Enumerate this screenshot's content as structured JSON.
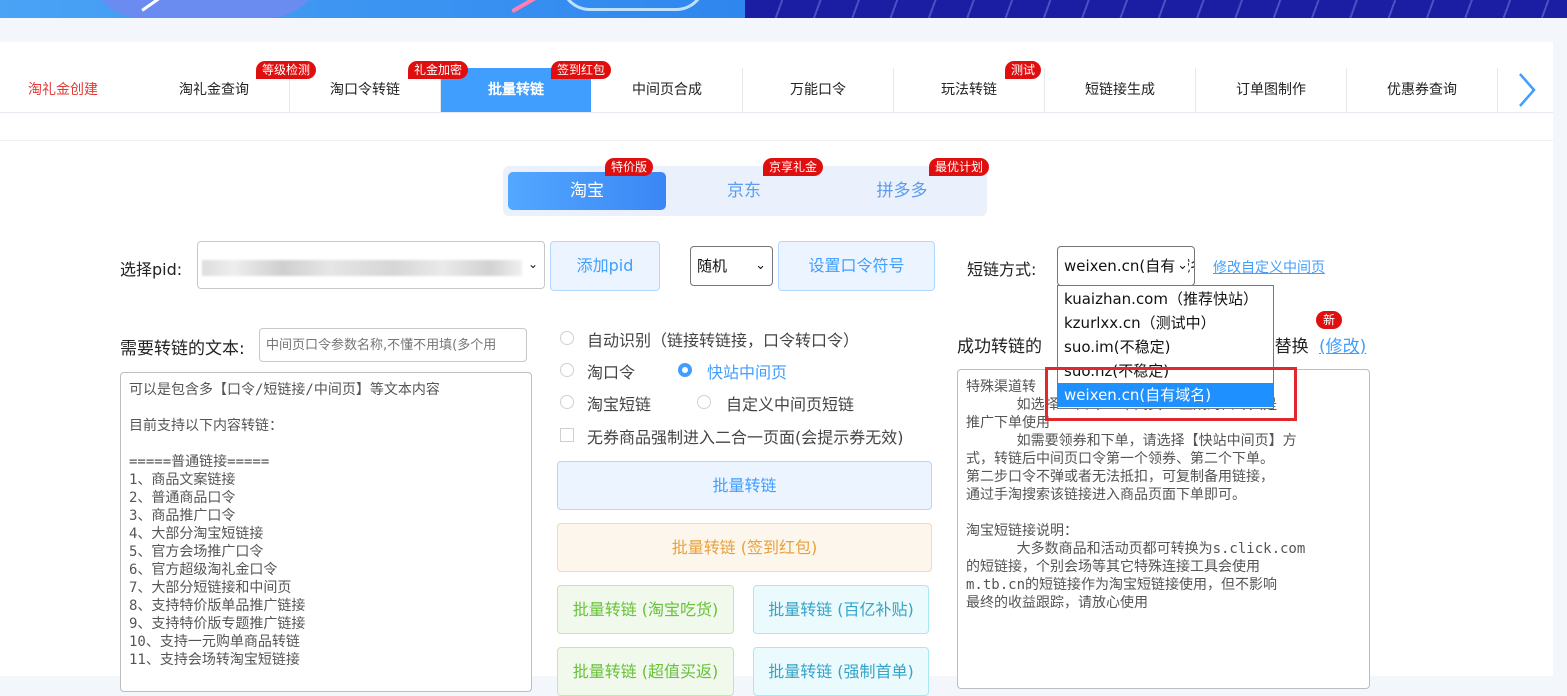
{
  "nav": {
    "tabs": [
      {
        "label": "淘礼金创建"
      },
      {
        "label": "淘礼金查询"
      },
      {
        "label": "淘口令转链"
      },
      {
        "label": "批量转链"
      },
      {
        "label": "中间页合成"
      },
      {
        "label": "万能口令"
      },
      {
        "label": "玩法转链"
      },
      {
        "label": "短链接生成"
      },
      {
        "label": "订单图制作"
      },
      {
        "label": "优惠券查询"
      }
    ],
    "badges": {
      "grade": "等级检测",
      "encrypt": "礼金加密",
      "redpack": "签到红包",
      "test": "测试"
    },
    "next_icon": "chevron-right-icon"
  },
  "platforms": {
    "items": [
      {
        "label": "淘宝",
        "badge": "特价版"
      },
      {
        "label": "京东",
        "badge": "京享礼金"
      },
      {
        "label": "拼多多",
        "badge": "最优计划"
      }
    ]
  },
  "pid": {
    "label": "选择pid:",
    "add_button": "添加pid",
    "random_value": "随机",
    "set_symbol_button": "设置口令符号"
  },
  "shortlink": {
    "label": "短链方式:",
    "selected": "weixen.cn(自有域名)",
    "edit_link": "修改自定义中间页",
    "options": [
      "kuaizhan.com（推荐快站）",
      "kzurlxx.cn（测试中）",
      "suo.im(不稳定)",
      "suo.nz(不稳定)",
      "weixen.cn(自有域名)"
    ]
  },
  "input": {
    "label": "需要转链的文本:",
    "param_placeholder": "中间页口令参数名称,不懂不用填(多个用",
    "text": "可以是包含多【口令/短链接/中间页】等文本内容\n\n目前支持以下内容转链：\n\n=====普通链接=====\n1、商品文案链接\n2、普通商品口令\n3、商品推广口令\n4、大部分淘宝短链接\n5、官方会场推广口令\n6、官方超级淘礼金口令\n7、大部分短链接和中间页\n8、支持特价版单品推广链接\n9、支持特价版专题推广链接\n10、支持一元购单商品转链\n11、支持会场转淘宝短链接"
  },
  "options": {
    "auto": "自动识别（链接转链接，口令转口令）",
    "tkl": "淘口令",
    "kuaizhan": "快站中间页",
    "taobao_short": "淘宝短链",
    "custom_mid": "自定义中间页短链",
    "force_checkbox": "无券商品强制进入二合一页面(会提示券无效)"
  },
  "buttons": {
    "batch": "批量转链",
    "batch_redpack": "批量转链 (签到红包)",
    "batch_food": "批量转链 (淘宝吃货)",
    "batch_subsidy": "批量转链 (百亿补贴)",
    "batch_cashback": "批量转链 (超值买返)",
    "batch_first": "批量转链 (强制首单)"
  },
  "output": {
    "label_left": "成功转链的",
    "label_right": "]替换",
    "edit_link": "(修改)",
    "new_badge": "新",
    "text": "特殊渠道转\n      如选择  口令  中间页  生成的口令只是\n推广下单使用\n      如需要领券和下单，请选择【快站中间页】方\n式，转链后中间页口令第一个领券、第二个下单。\n第二步口令不弹或者无法抵扣，可复制备用链接，\n通过手淘搜索该链接进入商品页面下单即可。\n\n淘宝短链接说明：\n      大多数商品和活动页都可转换为s.click.com\n的短链接，个别会场等其它特殊连接工具会使用\nm.tb.cn的短链接作为淘宝短链接使用，但不影响\n最终的收益跟踪，请放心使用"
  }
}
